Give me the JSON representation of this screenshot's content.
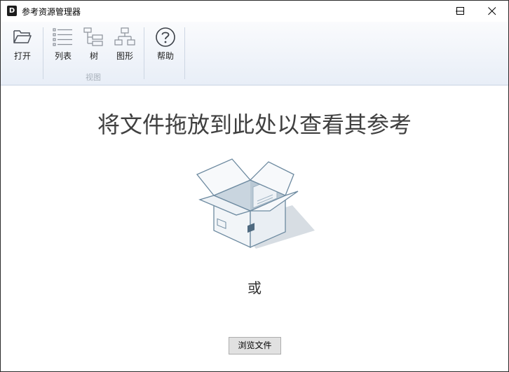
{
  "window": {
    "title": "参考资源管理器",
    "app_icon_letter": "D"
  },
  "titlebar_controls": [
    "minimize-icon",
    "maximize-icon",
    "close-icon"
  ],
  "ribbon": {
    "open_label": "打开",
    "list_label": "列表",
    "tree_label": "树",
    "graph_label": "图形",
    "view_group_label": "视图",
    "help_label": "帮助"
  },
  "main": {
    "heading": "将文件拖放到此处以查看其参考",
    "or_text": "或",
    "browse_label": "浏览文件"
  },
  "colors": {
    "ribbon_top": "#fafbfd",
    "ribbon_bottom": "#e8eef7",
    "icon_gray": "#5a6068"
  }
}
